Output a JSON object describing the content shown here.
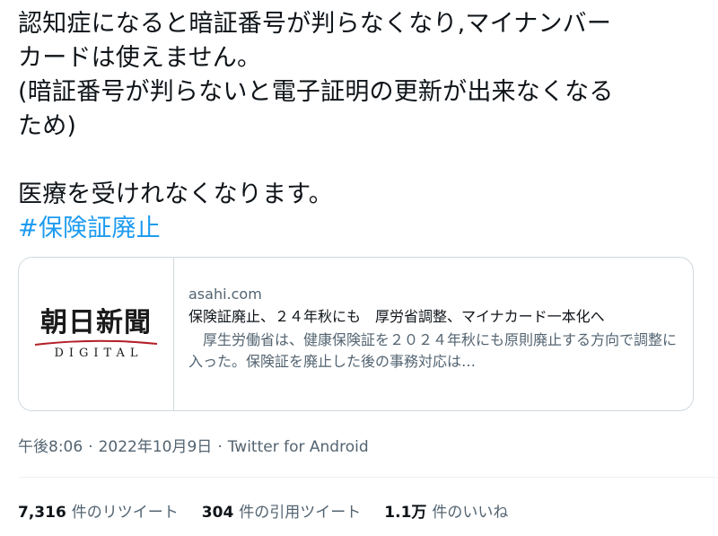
{
  "tweet": {
    "lines": [
      "認知症になると暗証番号が判らなくなり,マイナンバー",
      "カードは使えません。",
      "(暗証番号が判らないと電子証明の更新が出来なくなる",
      "ため)",
      "",
      "医療を受けれなくなります。"
    ],
    "hashtag": "#保険証廃止"
  },
  "card": {
    "logo_kanji": "朝日新聞",
    "logo_sub": "DIGITAL",
    "domain": "asahi.com",
    "title": "保険証廃止、２４年秋にも　厚労省調整、マイナカード一本化へ",
    "description": "　厚生労働省は、健康保険証を２０２４年秋にも原則廃止する方向で調整に入った。保険証を廃止した後の事務対応は…"
  },
  "meta": {
    "time": "午後8:06",
    "date": "2022年10月9日",
    "source": "Twitter for Android"
  },
  "stats": {
    "retweets_count": "7,316",
    "retweets_label": "件のリツイート",
    "quotes_count": "304",
    "quotes_label": "件の引用ツイート",
    "likes_count": "1.1万",
    "likes_label": "件のいいね"
  },
  "colors": {
    "hashtag": "#1d9bf0",
    "secondary_text": "#536471",
    "border": "#cfd9de",
    "logo_swoosh": "#b3202a"
  }
}
